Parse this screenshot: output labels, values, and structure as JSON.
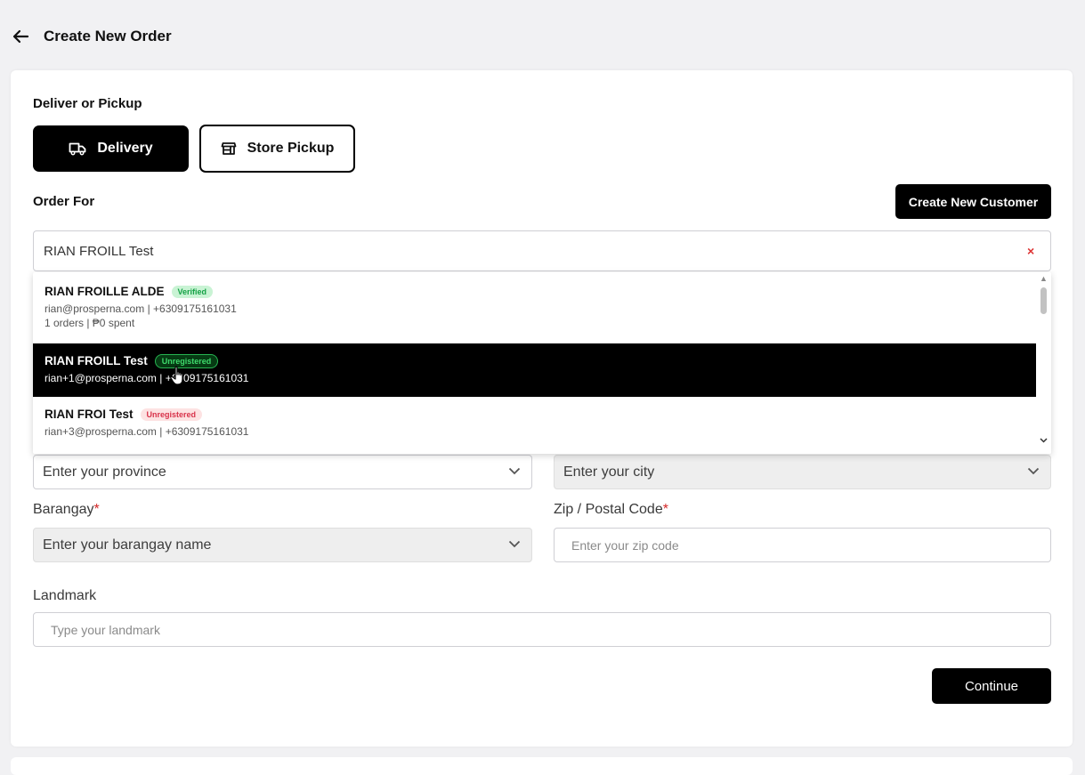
{
  "header": {
    "title": "Create New Order",
    "back_icon": "arrow-left-icon"
  },
  "deliver_section": {
    "label": "Deliver or Pickup",
    "delivery_label": "Delivery",
    "delivery_icon": "truck-icon",
    "pickup_label": "Store Pickup",
    "pickup_icon": "store-icon",
    "selected": "Delivery"
  },
  "order_for": {
    "label": "Order For",
    "create_customer_label": "Create New Customer",
    "search_value": "RIAN FROILL Test",
    "clear_symbol": "×"
  },
  "customer_results": [
    {
      "name": "RIAN FROILLE ALDE",
      "badge": "Verified",
      "line1": "rian@prosperna.com | +6309175161031",
      "line2": "1 orders | ₱0 spent"
    },
    {
      "name": "RIAN FROILL Test",
      "badge": "Unregistered",
      "line1": "rian+1@prosperna.com | +6309175161031",
      "selected": true
    },
    {
      "name": "RIAN FROI Test",
      "badge": "Unregistered",
      "line1": "rian+3@prosperna.com | +6309175161031"
    }
  ],
  "address": {
    "province_placeholder": "Enter your province",
    "city_placeholder": "Enter your city",
    "barangay_label": "Barangay",
    "barangay_placeholder": "Enter your barangay name",
    "zip_label": "Zip / Postal Code",
    "zip_placeholder": "Enter your zip code",
    "required_mark": "*",
    "landmark_label": "Landmark",
    "landmark_placeholder": "Type your landmark"
  },
  "actions": {
    "continue_label": "Continue"
  },
  "colors": {
    "primary": "#000000",
    "verified_bg": "#c9f3d4",
    "verified_text": "#14a145",
    "unregistered_bg": "#fde2e2",
    "unregistered_text": "#d8324a",
    "required": "#d32626"
  }
}
